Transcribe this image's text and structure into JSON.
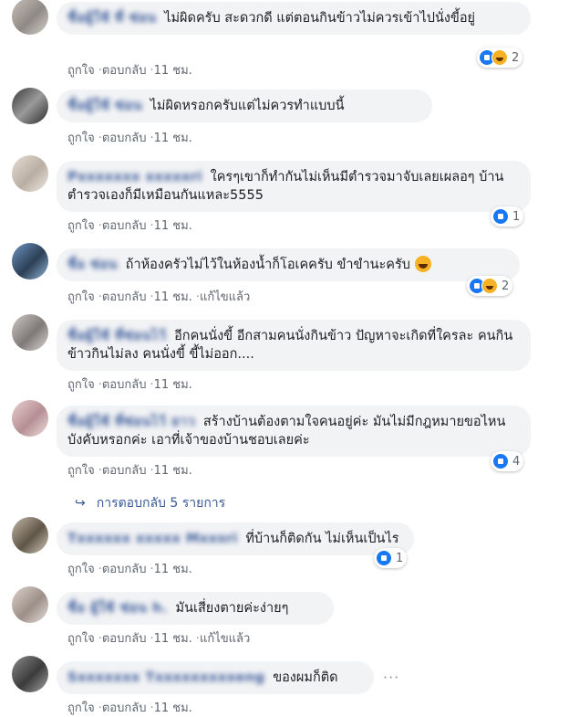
{
  "action_labels": {
    "like": "ถูกใจ",
    "reply": "ตอบกลับ",
    "edited": "แก้ไขแล้ว",
    "dot": "·"
  },
  "comments": [
    {
      "author": "ชื่อผู้ใช้ ที่ ซ่อน",
      "text": "ไม่ผิดครับ สะดวกดี แต่ตอนกินข้าวไม่ควรเข้าไปนั่งขี้อยู่",
      "time": "11 ชม.",
      "reactions": "2",
      "react_icons": [
        "like-icon",
        "haha-icon"
      ]
    },
    {
      "author": "ชื่อผู้ใช้ ซ่อน",
      "text": "ไม่ผิดหรอกครับแต่ไม่ควรทำแบบนี้",
      "time": "11 ชม."
    },
    {
      "author": "Pxxxxxxx xxxxxri",
      "text": "ใครๆเขาก็ทำกันไม่เห็นมีตำรวจมาจับเลยเผลอๆ บ้านตำรวจเองก็มีเหมือนกันแหละ5555",
      "time": "11 ชม.",
      "reactions": "1",
      "react_icons": [
        "like-icon"
      ]
    },
    {
      "author": "ชื่อ ซ่อน",
      "text": "ถ้าห้องครัวไม่ไว้ในห้องน้ำก็โอเคครับ ขำขำนะครับ",
      "time": "11 ชม.",
      "edited": true,
      "reactions": "2",
      "react_icons": [
        "like-icon",
        "haha-icon"
      ]
    },
    {
      "author": "ชื่อผู้ใช้ ที่ซ่อนไว้",
      "text": "อีกคนนั่งขี้ อีกสามคนนั่งกินข้าว ปัญหาจะเกิดที่ใครละ คนกินข้าวกินไม่ลง คนนั่งขี้ ขี้ไม่ออก....",
      "time": "11 ชม."
    },
    {
      "author": "ชื่อผู้ใช้ ที่ซ่อนไว้ ยาว",
      "text": "สร้างบ้านต้องตามใจคนอยู่ค่ะ มันไม่มีกฎหมายขอไหนบังคับหรอกค่ะ เอาที่เจ้าของบ้านชอบเลยค่ะ",
      "time": "11 ชม.",
      "reactions": "4",
      "react_icons": [
        "like-icon"
      ]
    },
    {
      "author": "Txxxxxx xxxxx Mxxsri",
      "text": "ที่บ้านก็ติดกัน ไม่เห็นเป็นไร",
      "time": "11 ชม.",
      "reactions": "1",
      "react_icons": [
        "like-icon"
      ]
    },
    {
      "author": "ชื่อ ผู้ใช้ ซ่อน h.",
      "text": "มันเสี่ยงตายค่ะง่ายๆ",
      "time": "11 ชม.",
      "edited": true
    },
    {
      "author": "Sxxxxxxx Txxxxxxxxxeng",
      "text": "ของผมก็ติด",
      "time": "11 ชม."
    }
  ],
  "replies_link": "การตอบกลับ 5 รายการ",
  "icons": {
    "reply_arrow": "reply-arrow-icon",
    "more": "more-options-icon"
  }
}
